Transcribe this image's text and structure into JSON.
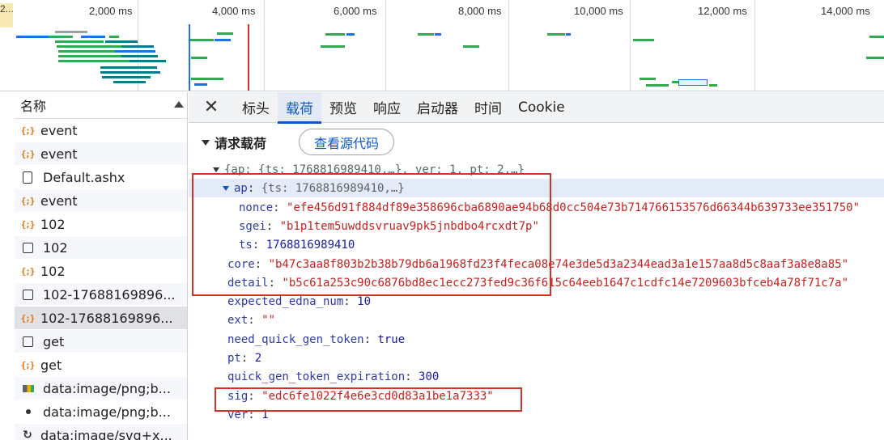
{
  "timeline": {
    "left_label": "2...",
    "ticks": [
      "2,000 ms",
      "4,000 ms",
      "6,000 ms",
      "8,000 ms",
      "10,000 ms",
      "12,000 ms",
      "14,000 ms"
    ]
  },
  "request_list": {
    "header": "名称",
    "rows": [
      {
        "icon": "json-icon",
        "label": "event",
        "selected": false
      },
      {
        "icon": "json-icon",
        "label": "event",
        "selected": false
      },
      {
        "icon": "document-icon",
        "label": "Default.ashx",
        "selected": false
      },
      {
        "icon": "json-icon",
        "label": "event",
        "selected": false
      },
      {
        "icon": "json-icon",
        "label": "102",
        "selected": false
      },
      {
        "icon": "checkbox-icon",
        "label": "102",
        "selected": false
      },
      {
        "icon": "json-icon",
        "label": "102",
        "selected": false
      },
      {
        "icon": "checkbox-icon",
        "label": "102-17688169896...",
        "selected": false
      },
      {
        "icon": "json-icon",
        "label": "102-17688169896...",
        "selected": true
      },
      {
        "icon": "checkbox-icon",
        "label": "get",
        "selected": false
      },
      {
        "icon": "json-icon",
        "label": "get",
        "selected": false
      },
      {
        "icon": "image-icon",
        "label": "data:image/png;b...",
        "selected": false
      },
      {
        "icon": "dot-icon",
        "label": "data:image/png;b...",
        "selected": false
      },
      {
        "icon": "refresh-icon",
        "label": "data:image/svg+x...",
        "selected": false
      }
    ]
  },
  "detail": {
    "tabs": [
      "标头",
      "载荷",
      "预览",
      "响应",
      "启动器",
      "时间",
      "Cookie"
    ],
    "active_tab": 1,
    "section_title": "请求载荷",
    "view_source_label": "查看源代码",
    "payload": {
      "root_summary": "{ap: {ts: 1768816989410,…}, ver: 1, pt: 2,…}",
      "ap_key": "ap",
      "ap_summary": "{ts: 1768816989410,…}",
      "fields_ap": [
        {
          "key": "nonce",
          "value": "\"efe456d91f884df89e358696cba6890ae94b68d0cc504e73b714766153576d66344b639733ee351750\"",
          "type": "string"
        },
        {
          "key": "sgei",
          "value": "\"b1p1tem5uwddsvruav9pk5jnbdbo4rcxdt7p\"",
          "type": "string"
        },
        {
          "key": "ts",
          "value": "1768816989410",
          "type": "number"
        }
      ],
      "fields_root": [
        {
          "key": "core",
          "value": "\"b47c3aa8f803b2b38b79db6a1968fd23f4feca08e74e3de5d3a2344ead3a1e157aa8d5c8aaf3a8e8a85\"",
          "type": "string"
        },
        {
          "key": "detail",
          "value": "\"b5c61a253c90c6876bd8ec1ecc273fed9c36f615c64eeb1647c1cdfc14e7209603bfceb4a78f71c7a\"",
          "type": "string"
        },
        {
          "key": "expected_edna_num",
          "value": "10",
          "type": "number"
        },
        {
          "key": "ext",
          "value": "\"\"",
          "type": "string"
        },
        {
          "key": "need_quick_gen_token",
          "value": "true",
          "type": "bool"
        },
        {
          "key": "pt",
          "value": "2",
          "type": "number"
        },
        {
          "key": "quick_gen_token_expiration",
          "value": "300",
          "type": "number"
        },
        {
          "key": "sig",
          "value": "\"edc6fe1022f4e6e3cd0d83a1be1a7333\"",
          "type": "string"
        },
        {
          "key": "ver",
          "value": "1",
          "type": "number"
        }
      ]
    }
  },
  "colors": {
    "accent": "#0b57d0",
    "string": "#c5221f",
    "key": "#2e3aa6",
    "highlight_box": "#d93025"
  }
}
